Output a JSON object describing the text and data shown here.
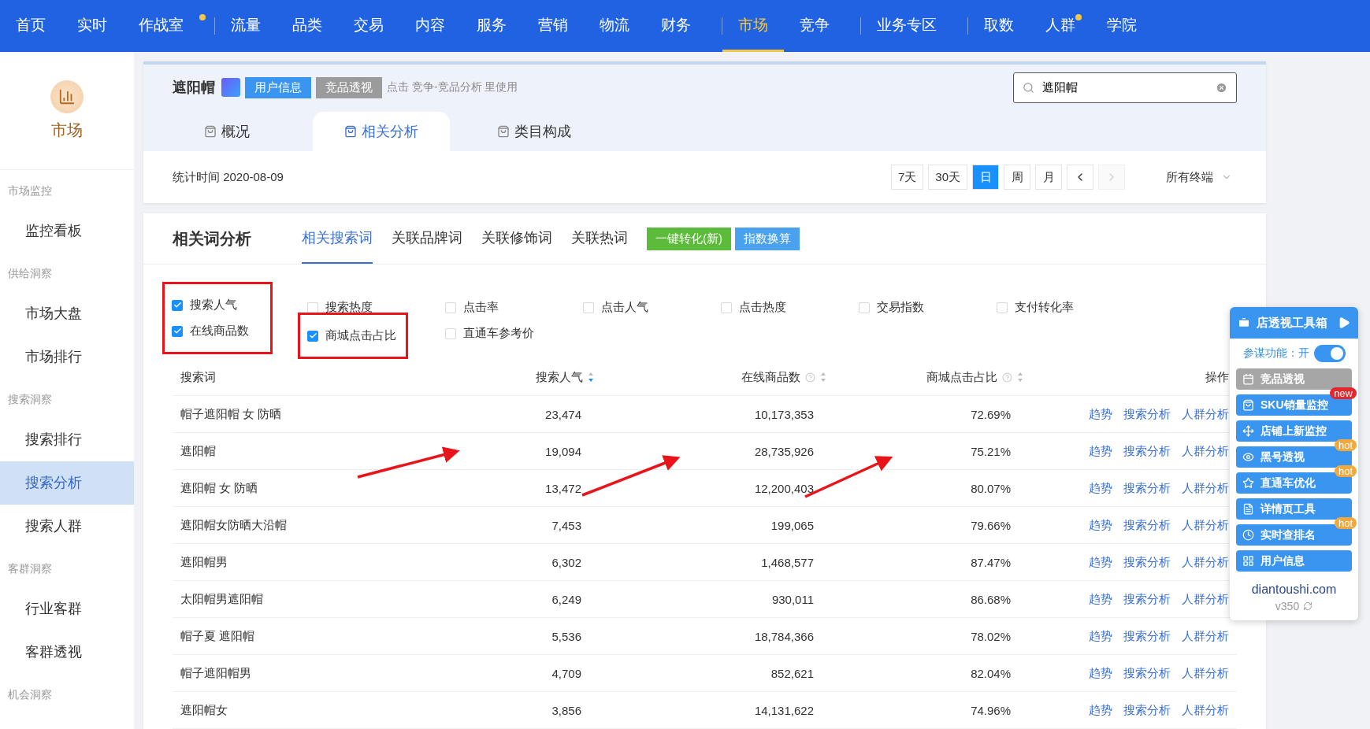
{
  "top_nav": [
    {
      "label": "首页",
      "selected": false,
      "dot": false,
      "divider_after": false
    },
    {
      "label": "实时",
      "selected": false,
      "dot": false,
      "divider_after": false
    },
    {
      "label": "作战室",
      "selected": false,
      "dot": true,
      "divider_after": true
    },
    {
      "label": "流量",
      "selected": false,
      "dot": false,
      "divider_after": false
    },
    {
      "label": "品类",
      "selected": false,
      "dot": false,
      "divider_after": false
    },
    {
      "label": "交易",
      "selected": false,
      "dot": false,
      "divider_after": false
    },
    {
      "label": "内容",
      "selected": false,
      "dot": false,
      "divider_after": false
    },
    {
      "label": "服务",
      "selected": false,
      "dot": false,
      "divider_after": false
    },
    {
      "label": "营销",
      "selected": false,
      "dot": false,
      "divider_after": false
    },
    {
      "label": "物流",
      "selected": false,
      "dot": false,
      "divider_after": false
    },
    {
      "label": "财务",
      "selected": false,
      "dot": false,
      "divider_after": true
    },
    {
      "label": "市场",
      "selected": true,
      "dot": false,
      "divider_after": false
    },
    {
      "label": "竞争",
      "selected": false,
      "dot": false,
      "divider_after": true
    },
    {
      "label": "业务专区",
      "selected": false,
      "dot": false,
      "divider_after": true
    },
    {
      "label": "取数",
      "selected": false,
      "dot": false,
      "divider_after": false
    },
    {
      "label": "人群",
      "selected": false,
      "dot": true,
      "divider_after": false
    },
    {
      "label": "学院",
      "selected": false,
      "dot": false,
      "divider_after": false
    }
  ],
  "sidebar": {
    "title": "市场",
    "groups": [
      {
        "label": "市场监控",
        "items": [
          {
            "label": "监控看板",
            "selected": false
          }
        ]
      },
      {
        "label": "供给洞察",
        "items": [
          {
            "label": "市场大盘",
            "selected": false
          },
          {
            "label": "市场排行",
            "selected": false
          }
        ]
      },
      {
        "label": "搜索洞察",
        "items": [
          {
            "label": "搜索排行",
            "selected": false
          },
          {
            "label": "搜索分析",
            "selected": true
          },
          {
            "label": "搜索人群",
            "selected": false
          }
        ]
      },
      {
        "label": "客群洞察",
        "items": [
          {
            "label": "行业客群",
            "selected": false
          },
          {
            "label": "客群透视",
            "selected": false
          }
        ]
      },
      {
        "label": "机会洞察"
      }
    ]
  },
  "header": {
    "keyword": "遮阳帽",
    "buttons": [
      {
        "label": "用户信息",
        "kind": "primary"
      },
      {
        "label": "竞品透视",
        "kind": "muted"
      }
    ],
    "hint": "点击 竞争-竞品分析 里使用",
    "search": {
      "value": "遮阳帽"
    },
    "tabs": [
      {
        "label": "概况",
        "selected": false
      },
      {
        "label": "相关分析",
        "selected": true
      },
      {
        "label": "类目构成",
        "selected": false
      }
    ],
    "stat_time": "统计时间 2020-08-09",
    "periods": [
      {
        "label": "7天",
        "selected": false
      },
      {
        "label": "30天",
        "selected": false
      },
      {
        "label": "日",
        "selected": true
      },
      {
        "label": "周",
        "selected": false
      },
      {
        "label": "月",
        "selected": false
      }
    ],
    "pager": [
      {
        "kind": "prev",
        "disabled": false
      },
      {
        "kind": "next",
        "disabled": true
      }
    ],
    "terminal": "所有终端"
  },
  "analysis": {
    "title": "相关词分析",
    "tabs": [
      {
        "label": "相关搜索词",
        "selected": true
      },
      {
        "label": "关联品牌词",
        "selected": false
      },
      {
        "label": "关联修饰词",
        "selected": false
      },
      {
        "label": "关联热词",
        "selected": false
      }
    ],
    "actions": [
      {
        "label": "一键转化(新)",
        "kind": "green"
      },
      {
        "label": "指数换算",
        "kind": "blue"
      }
    ],
    "option_columns": [
      [
        {
          "label": "搜索人气",
          "checked": true,
          "annotated": true
        },
        {
          "label": "在线商品数",
          "checked": true,
          "annotated": true
        }
      ],
      [
        {
          "label": "搜索热度",
          "checked": false,
          "annotated": false
        },
        {
          "label": "商城点击占比",
          "checked": true,
          "annotated": true
        }
      ],
      [
        {
          "label": "点击率",
          "checked": false,
          "annotated": false
        },
        {
          "label": "直通车参考价",
          "checked": false,
          "annotated": false
        }
      ],
      [
        {
          "label": "点击人气",
          "checked": false,
          "annotated": false
        }
      ],
      [
        {
          "label": "点击热度",
          "checked": false,
          "annotated": false
        }
      ],
      [
        {
          "label": "交易指数",
          "checked": false,
          "annotated": false
        }
      ],
      [
        {
          "label": "支付转化率",
          "checked": false,
          "annotated": false
        }
      ]
    ],
    "columns": [
      {
        "label": "搜索词"
      },
      {
        "label": "搜索人气",
        "sortable": true,
        "sorted": true,
        "help": false
      },
      {
        "label": "在线商品数",
        "sortable": true,
        "sorted": false,
        "help": true
      },
      {
        "label": "商城点击占比",
        "sortable": true,
        "sorted": false,
        "help": true
      },
      {
        "label": "操作"
      }
    ],
    "rows": [
      {
        "word": "帽子遮阳帽 女 防晒",
        "popularity": "23,474",
        "products": "10,173,353",
        "mall_share": "72.69%",
        "links": [
          "趋势",
          "搜索分析",
          "人群分析"
        ]
      },
      {
        "word": "遮阳帽",
        "popularity": "19,094",
        "products": "28,735,926",
        "mall_share": "75.21%",
        "links": [
          "趋势",
          "搜索分析",
          "人群分析"
        ]
      },
      {
        "word": "遮阳帽 女 防晒",
        "popularity": "13,472",
        "products": "12,200,403",
        "mall_share": "80.07%",
        "links": [
          "趋势",
          "搜索分析",
          "人群分析"
        ]
      },
      {
        "word": "遮阳帽女防晒大沿帽",
        "popularity": "7,453",
        "products": "199,065",
        "mall_share": "79.66%",
        "links": [
          "趋势",
          "搜索分析",
          "人群分析"
        ]
      },
      {
        "word": "遮阳帽男",
        "popularity": "6,302",
        "products": "1,468,577",
        "mall_share": "87.47%",
        "links": [
          "趋势",
          "搜索分析",
          "人群分析"
        ]
      },
      {
        "word": "太阳帽男遮阳帽",
        "popularity": "6,249",
        "products": "930,011",
        "mall_share": "86.68%",
        "links": [
          "趋势",
          "搜索分析",
          "人群分析"
        ]
      },
      {
        "word": "帽子夏 遮阳帽",
        "popularity": "5,536",
        "products": "18,784,366",
        "mall_share": "78.02%",
        "links": [
          "趋势",
          "搜索分析",
          "人群分析"
        ]
      },
      {
        "word": "帽子遮阳帽男",
        "popularity": "4,709",
        "products": "852,621",
        "mall_share": "82.04%",
        "links": [
          "趋势",
          "搜索分析",
          "人群分析"
        ]
      },
      {
        "word": "遮阳帽女",
        "popularity": "3,856",
        "products": "14,131,622",
        "mall_share": "74.96%",
        "links": [
          "趋势",
          "搜索分析",
          "人群分析"
        ]
      }
    ]
  },
  "toolbox": {
    "title": "店透视工具箱",
    "toggle": {
      "label": "参谋功能：开",
      "on": true
    },
    "items": [
      {
        "label": "竞品透视",
        "disabled": true
      },
      {
        "label": "SKU销量监控",
        "badge": "new",
        "disabled": false
      },
      {
        "label": "店铺上新监控",
        "disabled": false
      },
      {
        "label": "黑号透视",
        "badge": "hot",
        "disabled": false
      },
      {
        "label": "直通车优化",
        "badge": "hot",
        "disabled": false
      },
      {
        "label": "详情页工具",
        "disabled": false
      },
      {
        "label": "实时查排名",
        "badge": "hot",
        "disabled": false
      },
      {
        "label": "用户信息",
        "disabled": false
      }
    ],
    "site": "diantoushi.com",
    "version": "v350"
  }
}
